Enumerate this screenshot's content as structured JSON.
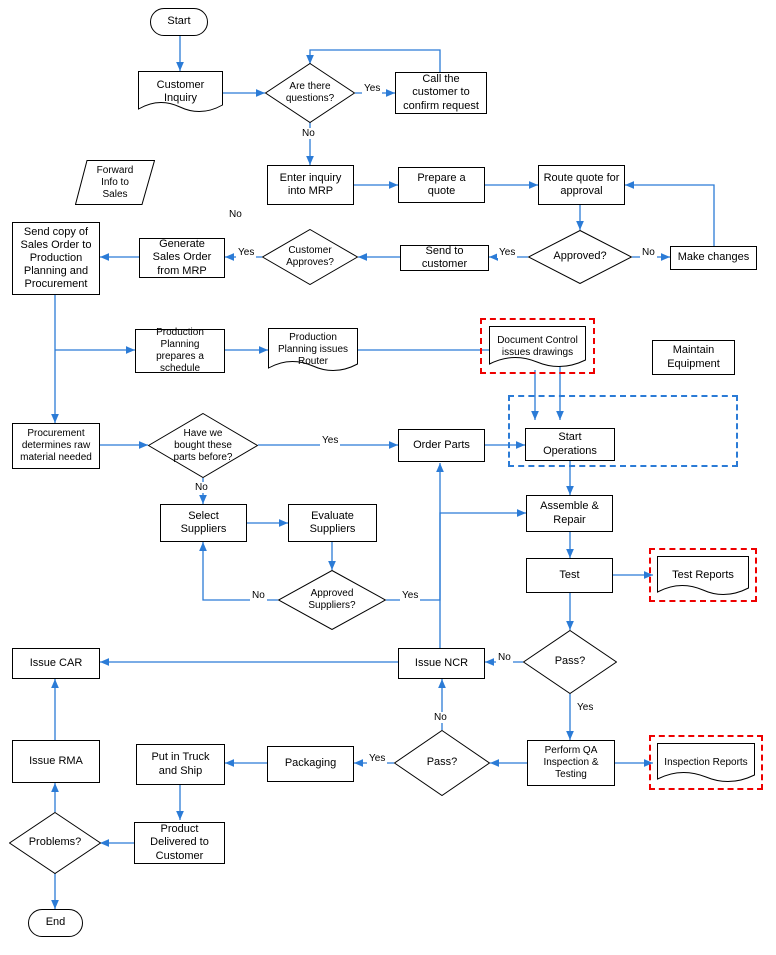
{
  "terminators": {
    "start": "Start",
    "end": "End"
  },
  "nodes": {
    "customer_inquiry": "Customer Inquiry",
    "questions": "Are there questions?",
    "call_customer": "Call the customer to confirm request",
    "forward_info": "Forward Info to Sales",
    "enter_mrp": "Enter inquiry into MRP",
    "prepare_quote": "Prepare a quote",
    "route_quote": "Route quote for approval",
    "send_copy": "Send copy of Sales Order to Production Planning and Procurement",
    "generate_so": "Generate Sales Order from MRP",
    "customer_approves": "Customer Approves?",
    "send_to_customer": "Send to customer",
    "approved": "Approved?",
    "make_changes": "Make changes",
    "prod_schedule": "Production Planning prepares a schedule",
    "prod_router": "Production Planning issues Router",
    "doc_control": "Document Control issues drawings",
    "maintain_equip": "Maintain Equipment",
    "procurement": "Procurement determines raw material needed",
    "bought_before": "Have we bought these parts before?",
    "order_parts": "Order Parts",
    "start_ops": "Start Operations",
    "select_suppliers": "Select Suppliers",
    "evaluate_suppliers": "Evaluate Suppliers",
    "approved_suppliers": "Approved Suppliers?",
    "assemble_repair": "Assemble & Repair",
    "test": "Test",
    "test_reports": "Test Reports",
    "issue_car": "Issue CAR",
    "issue_ncr": "Issue NCR",
    "pass1": "Pass?",
    "issue_rma": "Issue RMA",
    "put_truck": "Put in Truck and Ship",
    "packaging": "Packaging",
    "pass2": "Pass?",
    "perform_qa": "Perform QA Inspection & Testing",
    "inspection_reports": "Inspection Reports",
    "problems": "Problems?",
    "delivered": "Product Delivered to Customer"
  },
  "labels": {
    "yes": "Yes",
    "no": "No"
  }
}
